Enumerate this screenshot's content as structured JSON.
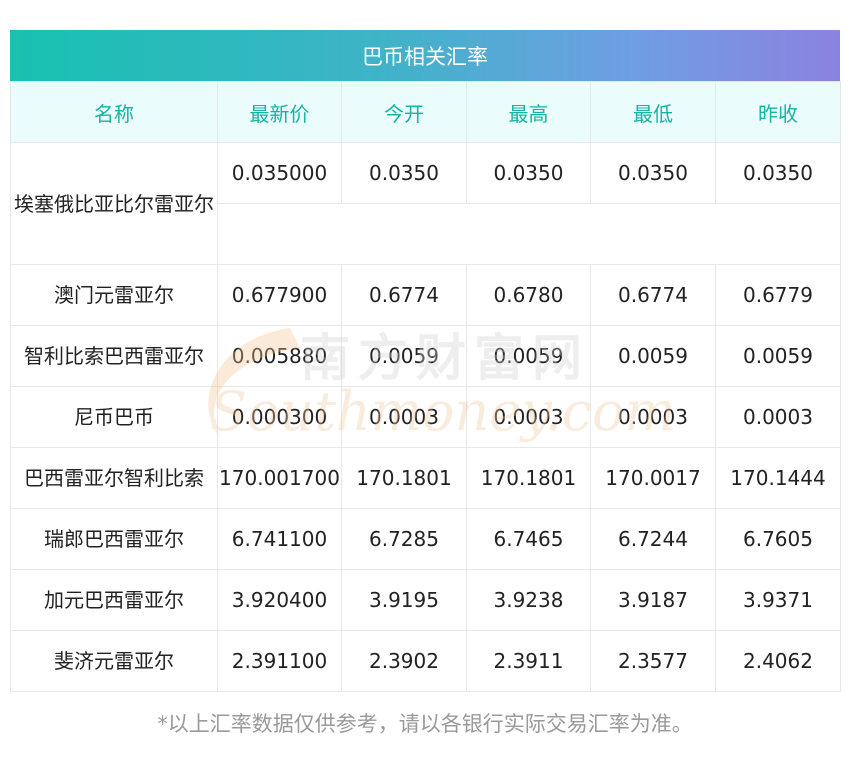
{
  "title": "巴币相关汇率",
  "columns": [
    "名称",
    "最新价",
    "今开",
    "最高",
    "最低",
    "昨收"
  ],
  "rows": [
    {
      "name": "埃塞俄比亚比尔雷亚尔",
      "last": "0.035000",
      "open": "0.0350",
      "high": "0.0350",
      "low": "0.0350",
      "prev": "0.0350"
    },
    {
      "name": "澳门元雷亚尔",
      "last": "0.677900",
      "open": "0.6774",
      "high": "0.6780",
      "low": "0.6774",
      "prev": "0.6779"
    },
    {
      "name": "智利比索巴西雷亚尔",
      "last": "0.005880",
      "open": "0.0059",
      "high": "0.0059",
      "low": "0.0059",
      "prev": "0.0059"
    },
    {
      "name": "尼币巴币",
      "last": "0.000300",
      "open": "0.0003",
      "high": "0.0003",
      "low": "0.0003",
      "prev": "0.0003"
    },
    {
      "name": "巴西雷亚尔智利比索",
      "last": "170.001700",
      "open": "170.1801",
      "high": "170.1801",
      "low": "170.0017",
      "prev": "170.1444"
    },
    {
      "name": "瑞郎巴西雷亚尔",
      "last": "6.741100",
      "open": "6.7285",
      "high": "6.7465",
      "low": "6.7244",
      "prev": "6.7605"
    },
    {
      "name": "加元巴西雷亚尔",
      "last": "3.920400",
      "open": "3.9195",
      "high": "3.9238",
      "low": "3.9187",
      "prev": "3.9371"
    },
    {
      "name": "斐济元雷亚尔",
      "last": "2.391100",
      "open": "2.3902",
      "high": "2.3911",
      "low": "2.3577",
      "prev": "2.4062"
    }
  ],
  "watermark": {
    "cn": "南方财富网",
    "en": "Southmoney.com"
  },
  "footnote": "*以上汇率数据仅供参考，请以各银行实际交易汇率为准。",
  "colors": {
    "header_text": "#17b3a3",
    "header_bg": "#eafcfb",
    "gradient_start": "#17c1b0",
    "gradient_end": "#8b82df"
  }
}
